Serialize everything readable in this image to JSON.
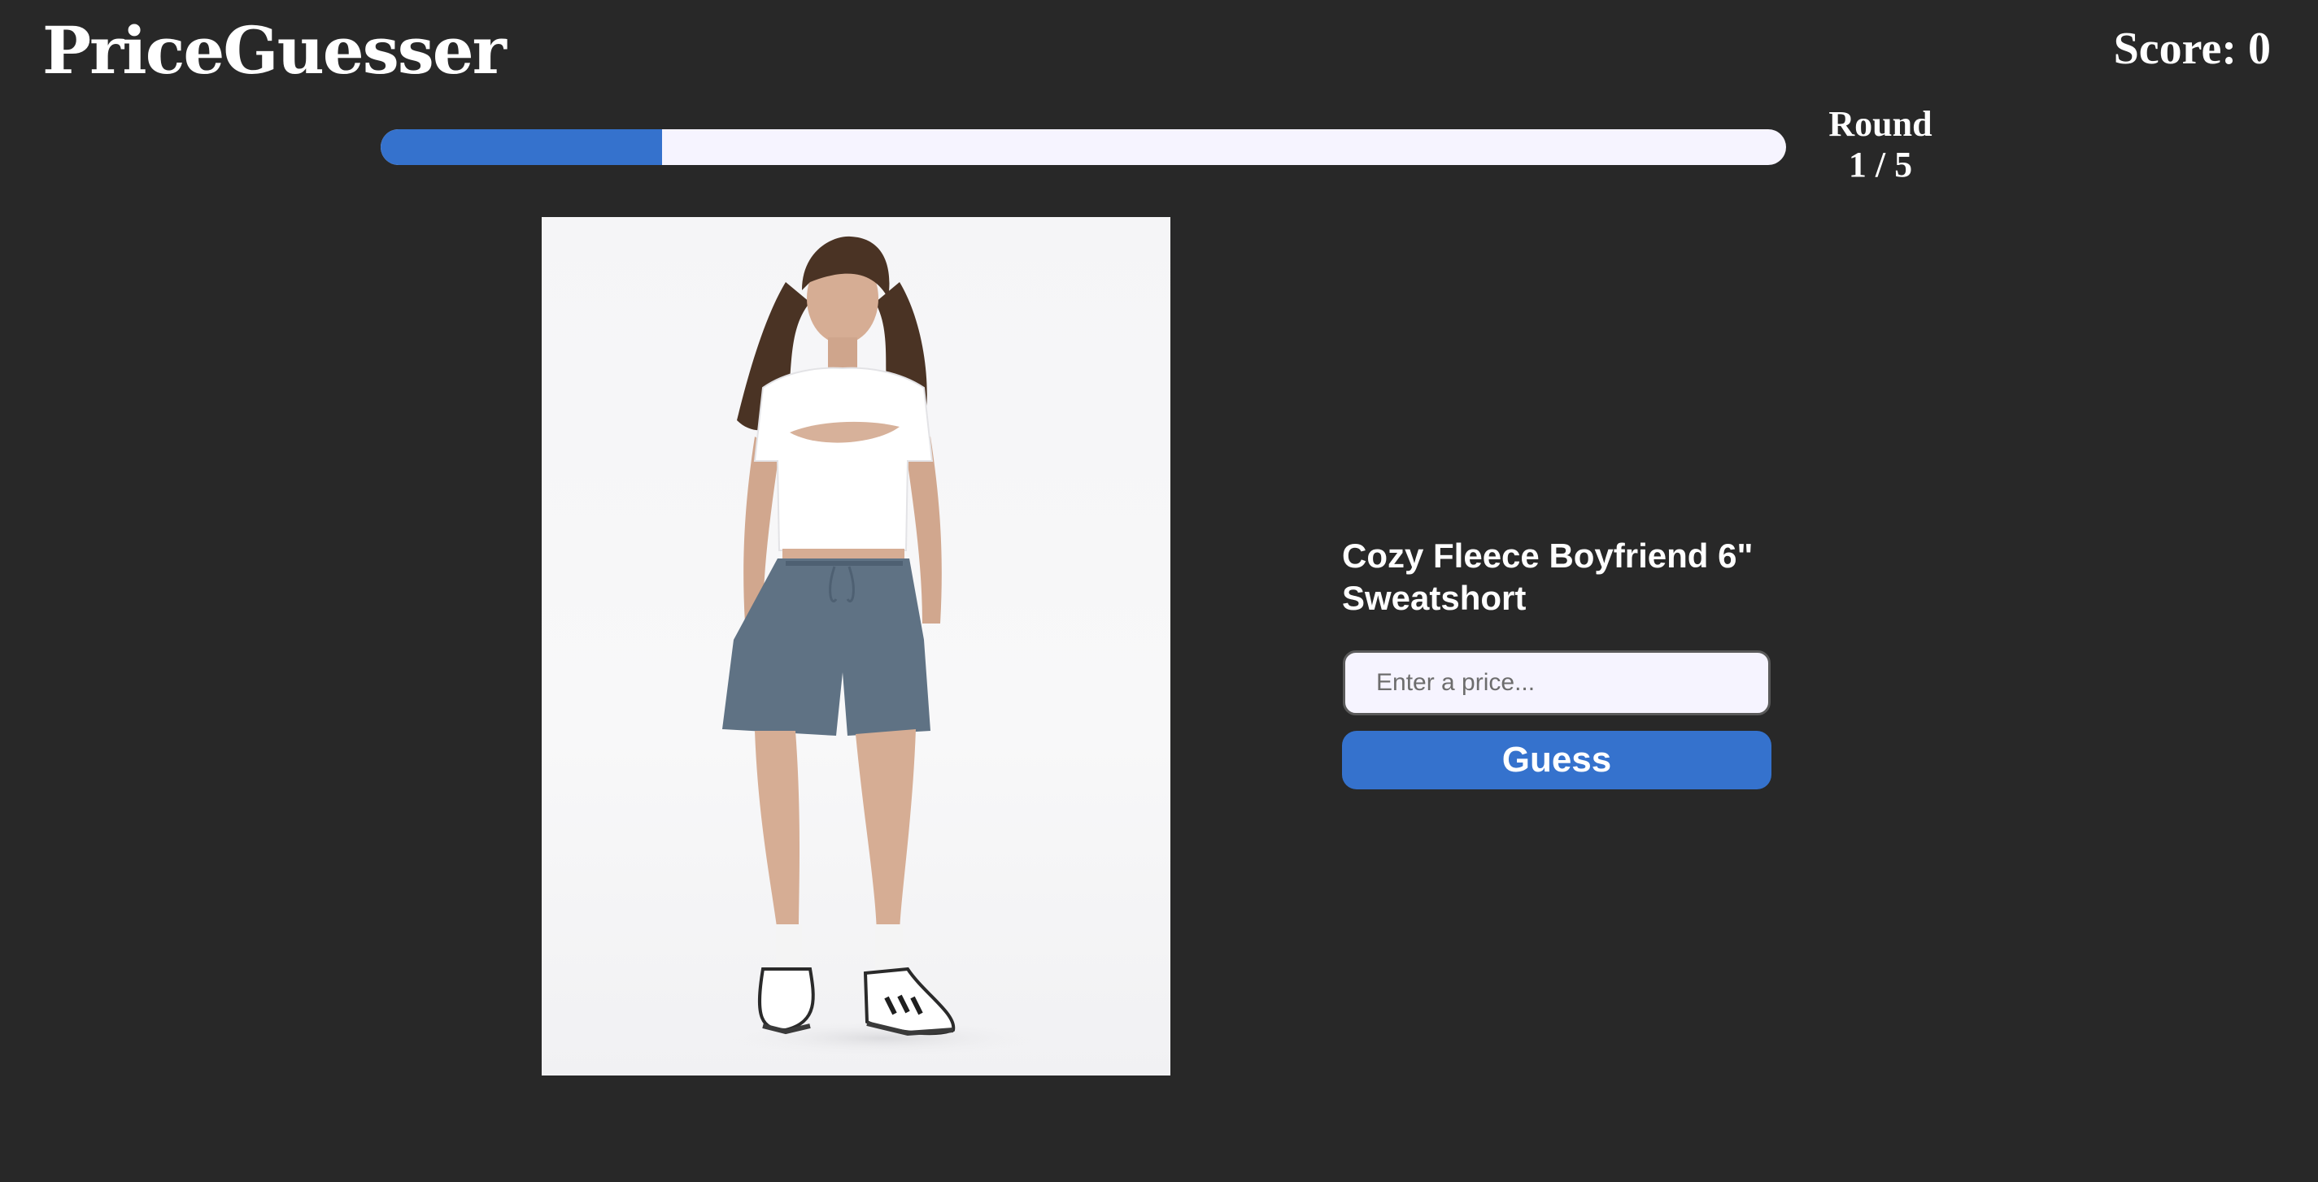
{
  "app": {
    "title": "PriceGuesser"
  },
  "score": {
    "label": "Score: 0",
    "value": 0
  },
  "round": {
    "label": "Round",
    "progress_text": "1 / 5",
    "current": 1,
    "total": 5,
    "progress_fraction": 0.2
  },
  "product": {
    "name": "Cozy Fleece Boyfriend 6\" Sweatshort",
    "image_description_icon": "product-photo"
  },
  "guess": {
    "placeholder": "Enter a price...",
    "value": "",
    "button_label": "Guess"
  },
  "colors": {
    "background": "#282828",
    "accent": "#3572cd",
    "track": "#f6f4ff",
    "text": "#ffffff"
  }
}
